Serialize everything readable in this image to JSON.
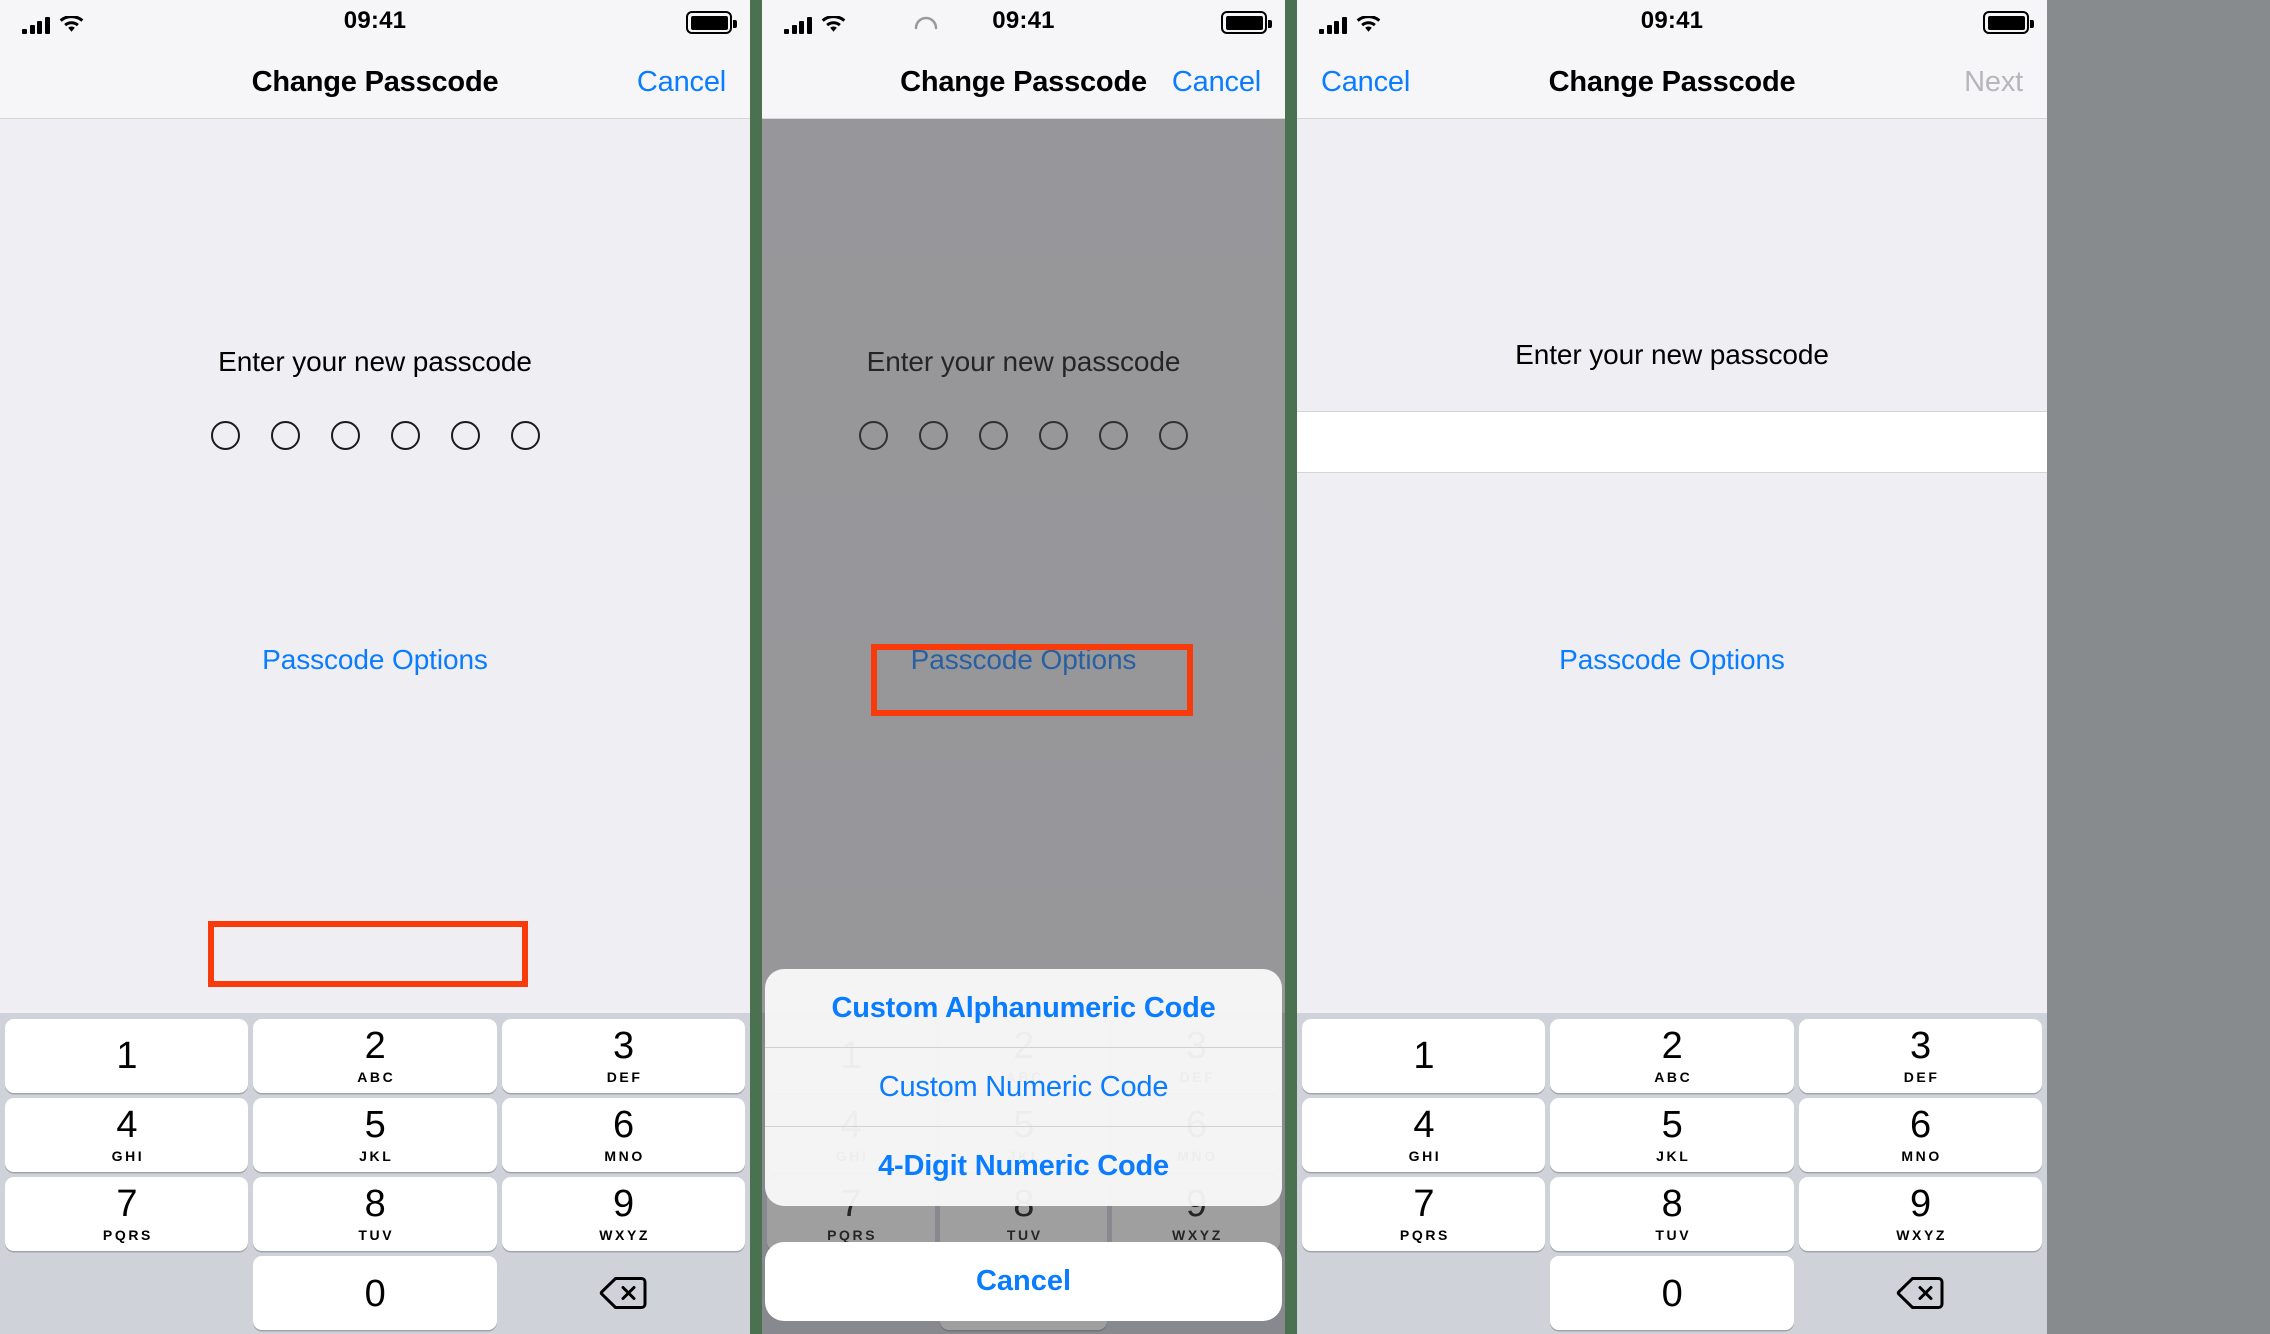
{
  "status_bar": {
    "time": "09:41",
    "signal_icon": "cellular-bars-icon",
    "wifi_icon": "wifi-icon",
    "battery_icon": "battery-full-icon"
  },
  "colors": {
    "accent_blue": "#0a7cff",
    "annotation_red": "#F93B0C",
    "panel_divider_green": "#4a7150",
    "body_bg": "#EFEEF3",
    "keypad_bg": "#CFD2D9"
  },
  "keypad": {
    "keys": [
      {
        "num": "1",
        "letters": ""
      },
      {
        "num": "2",
        "letters": "ABC"
      },
      {
        "num": "3",
        "letters": "DEF"
      },
      {
        "num": "4",
        "letters": "GHI"
      },
      {
        "num": "5",
        "letters": "JKL"
      },
      {
        "num": "6",
        "letters": "MNO"
      },
      {
        "num": "7",
        "letters": "PQRS"
      },
      {
        "num": "8",
        "letters": "TUV"
      },
      {
        "num": "9",
        "letters": "WXYZ"
      },
      {
        "num": "0",
        "letters": ""
      }
    ],
    "delete_icon": "backspace-delete-icon"
  },
  "panel1": {
    "nav": {
      "title": "Change Passcode",
      "right_button": "Cancel"
    },
    "prompt": "Enter your new passcode",
    "dot_count": 6,
    "passcode_options": "Passcode Options",
    "highlight": "passcode-options-button"
  },
  "panel2": {
    "nav": {
      "title": "Change Passcode",
      "right_button": "Cancel"
    },
    "prompt": "Enter your new passcode",
    "dot_count": 6,
    "passcode_options": "Passcode Options",
    "action_sheet": {
      "items": [
        {
          "label": "Custom Alphanumeric Code",
          "bold": true
        },
        {
          "label": "Custom Numeric Code",
          "bold": false
        },
        {
          "label": "4-Digit Numeric Code",
          "bold": true
        }
      ],
      "cancel": "Cancel"
    },
    "highlight": "custom-numeric-code-option"
  },
  "panel3": {
    "nav": {
      "title": "Change Passcode",
      "left_button": "Cancel",
      "right_button": "Next",
      "right_disabled": true
    },
    "prompt": "Enter your new passcode",
    "passcode_options": "Passcode Options"
  }
}
